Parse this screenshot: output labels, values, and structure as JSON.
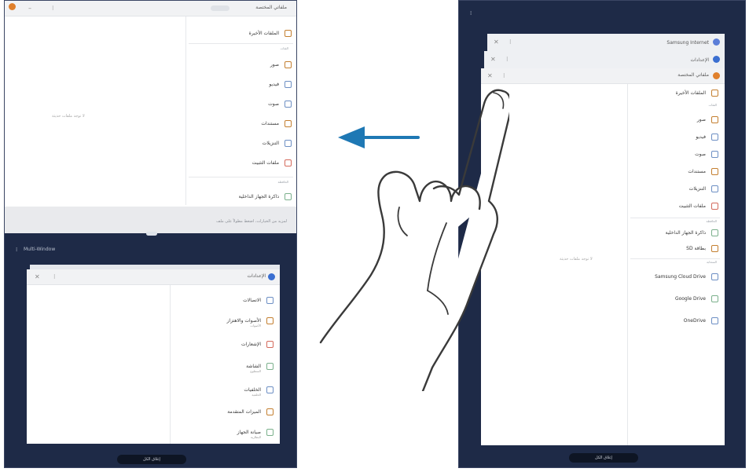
{
  "left": {
    "top_window": {
      "title": "ملفاتي المختصة",
      "toolbar_hint": "بحث",
      "first_item": "الملفات الأخيرة",
      "section_label": "الفئات",
      "items": [
        "صور",
        "فيديو",
        "صوت",
        "مستندات",
        "التنزيلات",
        "ملفات التثبيت"
      ],
      "storage_label": "الحافظة",
      "storage_item": "ذاكرة الجهاز الداخلية",
      "empty_text": "لا توجد ملفات حديثة",
      "footer_text": "لمزيد من الخيارات، اضغط مطولاً على ملف"
    },
    "bottom_window": {
      "status_title": "Multi-Window",
      "title": "الإعدادات",
      "items": [
        {
          "label": "الاتصالات",
          "sub": "Wi-Fi، Bluetooth"
        },
        {
          "label": "الأصوات والاهتزاز",
          "sub": "الأصوات"
        },
        {
          "label": "الإشعارات",
          "sub": ""
        },
        {
          "label": "الشاشة",
          "sub": "السطوع"
        },
        {
          "label": "الخلفيات",
          "sub": "الخلفية"
        },
        {
          "label": "الميزات المتقدمة",
          "sub": ""
        },
        {
          "label": "صيانة الجهاز",
          "sub": "البطارية"
        }
      ],
      "close_all": "إغلاق الكل"
    }
  },
  "right": {
    "back_window_1": {
      "title": "Samsung Internet"
    },
    "back_window_2": {
      "title": "الإعدادات"
    },
    "front_window": {
      "title": "ملفاتي المختصة",
      "first_item": "الملفات الأخيرة",
      "section_label": "الفئات",
      "items": [
        "صور",
        "فيديو",
        "صوت",
        "مستندات",
        "التنزيلات",
        "ملفات التثبيت"
      ],
      "storage_label": "الحافظة",
      "storage_items": [
        "ذاكرة الجهاز الداخلية",
        "بطاقة SD"
      ],
      "cloud_label": "السحابة",
      "cloud_items": [
        {
          "label": "Samsung Cloud Drive",
          "sub": ""
        },
        {
          "label": "Google Drive",
          "sub": ""
        },
        {
          "label": "OneDrive",
          "sub": ""
        }
      ],
      "empty_text": "لا توجد ملفات حديثة"
    },
    "close_all": "إغلاق الكل"
  },
  "colors": {
    "tablet_frame": "#1e2a47",
    "arrow": "#1e78b4",
    "app_accent": "#e0802c",
    "settings_accent": "#3b6fd1"
  },
  "icons": [
    "arrow-left-icon",
    "finger-hand-icon",
    "close-icon",
    "folder-icon"
  ]
}
